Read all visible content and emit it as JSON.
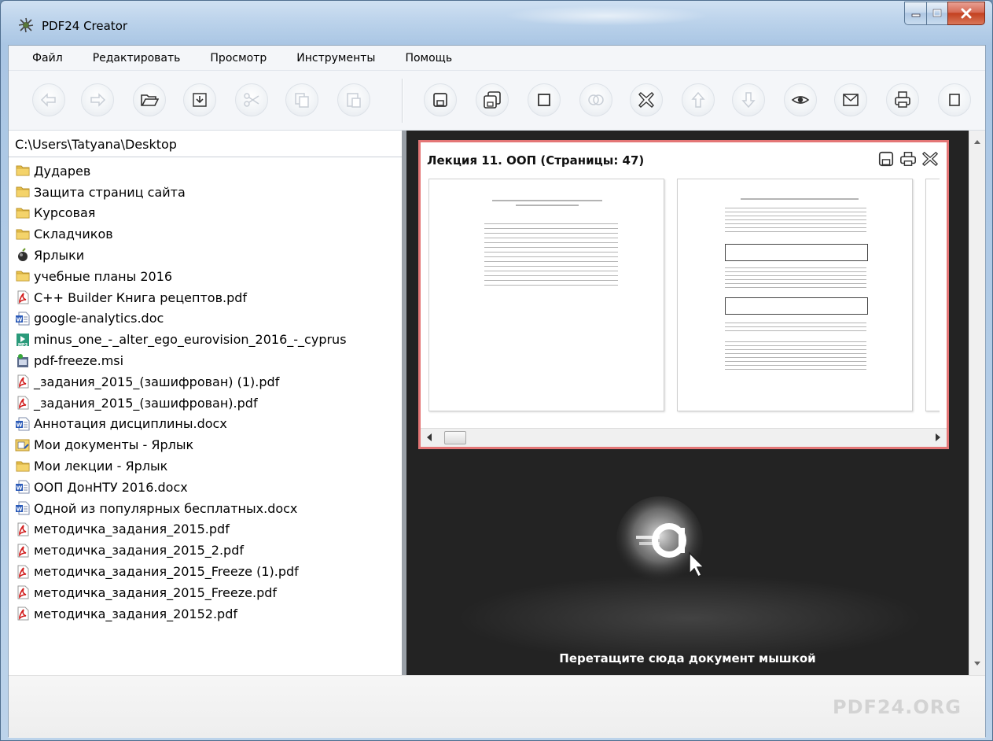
{
  "window": {
    "title": "PDF24 Creator"
  },
  "menu": [
    "Файл",
    "Редактировать",
    "Просмотр",
    "Инструменты",
    "Помощь"
  ],
  "toolbar": {
    "buttons": [
      "back-arrow",
      "forward-arrow",
      "open-folder",
      "import",
      "cut",
      "copy",
      "paste",
      "save",
      "save-all",
      "stop",
      "merge",
      "delete",
      "move-up",
      "move-down",
      "preview-eye",
      "email",
      "print",
      "more"
    ]
  },
  "explorer": {
    "path": "C:\\Users\\Tatyana\\Desktop",
    "items": [
      {
        "name": "Дударев",
        "type": "folder"
      },
      {
        "name": "Защита страниц сайта",
        "type": "folder"
      },
      {
        "name": "Курсовая",
        "type": "folder"
      },
      {
        "name": "Складчиков",
        "type": "folder"
      },
      {
        "name": "Ярлыки",
        "type": "shortcut-app"
      },
      {
        "name": "учебные планы 2016",
        "type": "folder"
      },
      {
        "name": "C++ Builder Книга рецептов.pdf",
        "type": "pdf"
      },
      {
        "name": "google-analytics.doc",
        "type": "doc"
      },
      {
        "name": "minus_one_-_alter_ego_eurovision_2016_-_cyprus",
        "type": "mp3"
      },
      {
        "name": "pdf-freeze.msi",
        "type": "msi"
      },
      {
        "name": "_задания_2015_(зашифрован) (1).pdf",
        "type": "pdf"
      },
      {
        "name": "_задания_2015_(зашифрован).pdf",
        "type": "pdf"
      },
      {
        "name": "Аннотация дисциплины.docx",
        "type": "doc"
      },
      {
        "name": "Мои документы - Ярлык",
        "type": "shortcut"
      },
      {
        "name": "Мои лекции - Ярлык",
        "type": "folder"
      },
      {
        "name": "ООП ДонНТУ 2016.docx",
        "type": "doc"
      },
      {
        "name": "Одной из популярных бесплатных.docx",
        "type": "doc"
      },
      {
        "name": "методичка_задания_2015.pdf",
        "type": "pdf"
      },
      {
        "name": "методичка_задания_2015_2.pdf",
        "type": "pdf"
      },
      {
        "name": "методичка_задания_2015_Freeze (1).pdf",
        "type": "pdf"
      },
      {
        "name": "методичка_задания_2015_Freeze.pdf",
        "type": "pdf"
      },
      {
        "name": "методичка_задания_20152.pdf",
        "type": "pdf"
      }
    ]
  },
  "document": {
    "title": "Лекция 11. ООП (Страницы: 47)",
    "actions": [
      "save-icon",
      "print-icon",
      "close-icon"
    ]
  },
  "dropzone": {
    "text": "Перетащите сюда документ мышкой"
  },
  "brand": "PDF24.ORG",
  "colors": {
    "accent": "#e47676",
    "dark_panel": "#232323"
  }
}
